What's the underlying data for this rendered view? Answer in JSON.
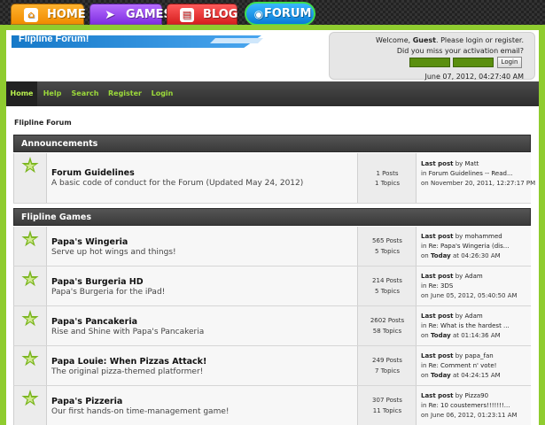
{
  "site_nav": {
    "home": "HOME",
    "games": "GAMES",
    "blog": "BLOG",
    "forum": "FORUM"
  },
  "header": {
    "logo_text": "Flipline Forum!",
    "welcome_prefix": "Welcome, ",
    "guest": "Guest",
    "welcome_suffix": ". Please login or register.",
    "activation": "Did you miss your activation email?",
    "login_button": "Login",
    "datetime": "June 07, 2012, 04:27:40 AM"
  },
  "menu": {
    "home": "Home",
    "help": "Help",
    "search": "Search",
    "register": "Register",
    "login": "Login"
  },
  "breadcrumb": "Flipline Forum",
  "categories": [
    {
      "name": "Announcements",
      "boards": [
        {
          "title": "Forum Guidelines",
          "desc": "A basic code of conduct for the Forum (Updated May 24, 2012)",
          "posts": "1 Posts",
          "topics": "1 Topics",
          "last_by": "Matt",
          "last_in": "Forum Guidelines -- Read...",
          "last_on": "November 20, 2011, 12:27:17 PM"
        }
      ]
    },
    {
      "name": "Flipline Games",
      "boards": [
        {
          "title": "Papa's Wingeria",
          "desc": "Serve up hot wings and things!",
          "posts": "565 Posts",
          "topics": "5 Topics",
          "last_by": "mohammed",
          "last_in": "Re: Papa's Wingeria (dis...",
          "last_on_bold": "Today",
          "last_on": "at 04:26:30 AM"
        },
        {
          "title": "Papa's Burgeria HD",
          "desc": "Papa's Burgeria for the iPad!",
          "posts": "214 Posts",
          "topics": "5 Topics",
          "last_by": "Adam",
          "last_in": "Re: 3DS",
          "last_on": "June 05, 2012, 05:40:50 AM"
        },
        {
          "title": "Papa's Pancakeria",
          "desc": "Rise and Shine with Papa's Pancakeria",
          "posts": "2602 Posts",
          "topics": "58 Topics",
          "last_by": "Adam",
          "last_in": "Re: What is the hardest ...",
          "last_on_bold": "Today",
          "last_on": "at 01:14:36 AM"
        },
        {
          "title": "Papa Louie: When Pizzas Attack!",
          "desc": "The original pizza-themed platformer!",
          "posts": "249 Posts",
          "topics": "7 Topics",
          "last_by": "papa_fan",
          "last_in": "Re: Comment n' vote!",
          "last_on_bold": "Today",
          "last_on": "at 04:24:15 AM"
        },
        {
          "title": "Papa's Pizzeria",
          "desc": "Our first hands-on time-management game!",
          "posts": "307 Posts",
          "topics": "11 Topics",
          "last_by": "Pizza90",
          "last_in": "Re: 10 coustemers!!!!!!!...",
          "last_on": "June 06, 2012, 01:23:11 AM"
        }
      ]
    }
  ],
  "labels": {
    "last_post": "Last post",
    "by": " by ",
    "in": "in ",
    "on": "on "
  }
}
